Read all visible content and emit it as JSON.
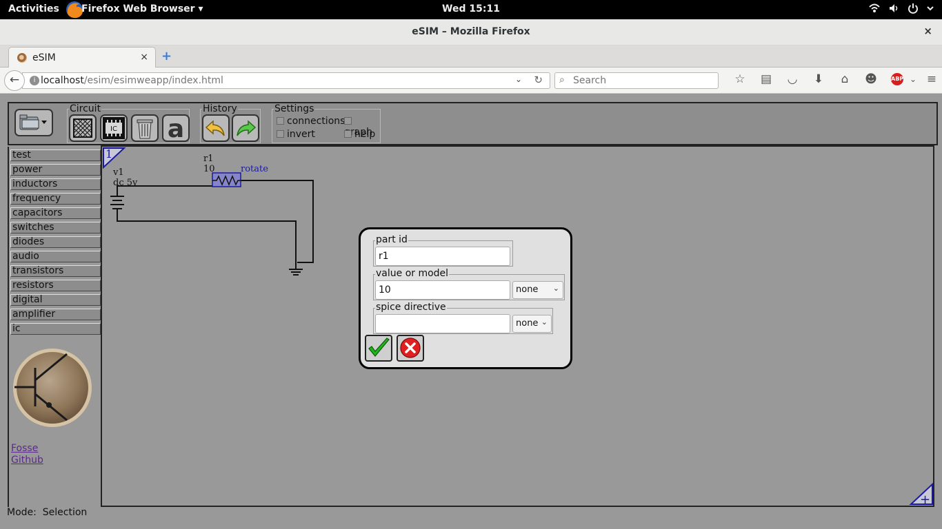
{
  "topbar": {
    "activities": "Activities",
    "app_name": "Firefox Web Browser ▾",
    "clock": "Wed 15:11"
  },
  "window": {
    "title": "eSIM – Mozilla Firefox",
    "close": "×"
  },
  "tab": {
    "label": "eSIM",
    "close": "×",
    "new_tab": "+"
  },
  "navbar": {
    "url_host": "localhost",
    "url_path": "/esim/esimweapp/index.html",
    "search_placeholder": "Search"
  },
  "toolbar": {
    "circuit_legend": "Circuit",
    "history_legend": "History",
    "settings_legend": "Settings",
    "text_tool_glyph": "a",
    "settings": [
      "connections",
      "graph",
      "invert",
      "help"
    ]
  },
  "library": {
    "items": [
      "test",
      "power",
      "inductors",
      "frequency",
      "capacitors",
      "switches",
      "diodes",
      "audio",
      "transistors",
      "resistors",
      "digital",
      "amplifier",
      "ic"
    ],
    "links": [
      "Fosse",
      "Github"
    ]
  },
  "canvas": {
    "page_number": "1",
    "v1_label": "v1",
    "v1_value": "dc 5v",
    "r1_label": "r1",
    "r1_value": "10",
    "rotate": "rotate",
    "corner_glyph": "+"
  },
  "dialog": {
    "part_id_legend": "part id",
    "part_id_value": "r1",
    "value_legend": "value or model",
    "value_value": "10",
    "value_select": "none",
    "spice_legend": "spice directive",
    "spice_value": "",
    "spice_select": "none"
  },
  "status": {
    "mode": "Mode:  Selection"
  },
  "colors": {
    "accent_blue": "#1a1aa0",
    "ok_green": "#22b41e",
    "cancel_red": "#e02020"
  }
}
